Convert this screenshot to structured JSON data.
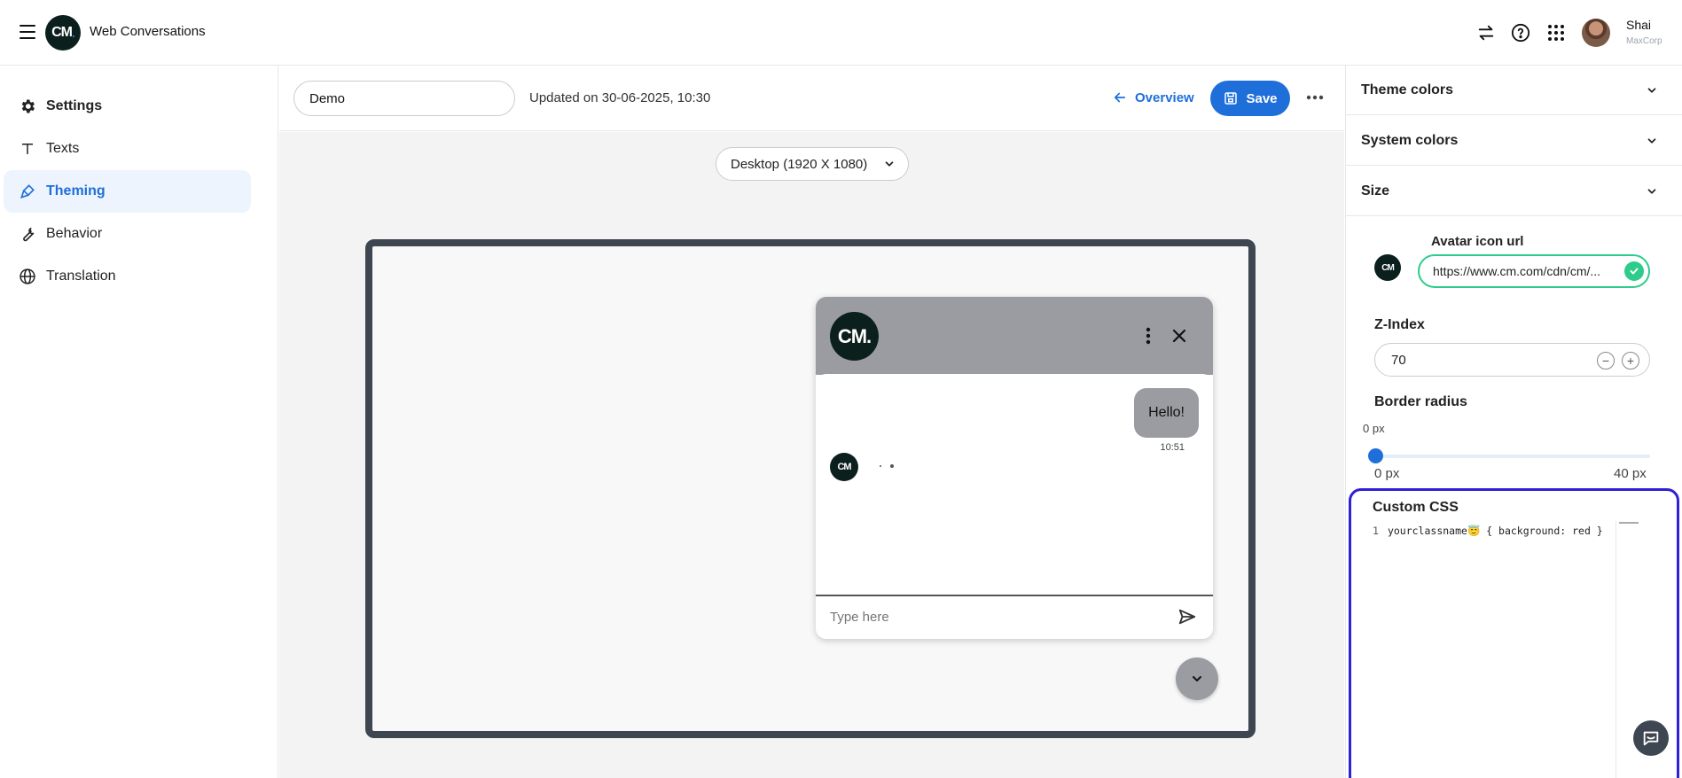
{
  "app": {
    "title": "Web Conversations",
    "logo_text": "CM",
    "logo_dot": "."
  },
  "user": {
    "name": "Shai",
    "org": "MaxCorp"
  },
  "sidebar": {
    "items": [
      {
        "label": "Settings",
        "icon": "gear-icon"
      },
      {
        "label": "Texts",
        "icon": "text-icon"
      },
      {
        "label": "Theming",
        "icon": "brush-icon",
        "active": true
      },
      {
        "label": "Behavior",
        "icon": "wrench-icon"
      },
      {
        "label": "Translation",
        "icon": "globe-icon"
      }
    ]
  },
  "toolbar": {
    "name_value": "Demo",
    "updated_text": "Updated on 30-06-2025, 10:30",
    "overview_label": "Overview",
    "save_label": "Save"
  },
  "preview": {
    "device_select_value": "Desktop (1920 X 1080)",
    "chat": {
      "logo_text": "CM.",
      "message": "Hello!",
      "message_time": "10:51",
      "bot_avatar_text": "CM",
      "input_placeholder": "Type here"
    }
  },
  "panel": {
    "accordions": [
      "Theme colors",
      "System colors",
      "Size"
    ],
    "avatar_label": "Avatar icon url",
    "avatar_url_value": "https://www.cm.com/cdn/cm/...",
    "avatar_icon_text": "CM",
    "zindex_label": "Z-Index",
    "zindex_value": "70",
    "border_radius_label": "Border radius",
    "border_radius_value": "0 px",
    "border_radius_fraction": 0,
    "slider_min": "0 px",
    "slider_max": "40 px",
    "custom_css_label": "Custom CSS",
    "code_line_number": "1",
    "code_line": "yourclassname😇 { background: red }"
  },
  "colors": {
    "accent": "#1e6fd9",
    "success": "#2ecc8a",
    "focus_outline": "#2f1fd6",
    "chat_header": "#9a9ca1",
    "frame": "#3d4651"
  }
}
